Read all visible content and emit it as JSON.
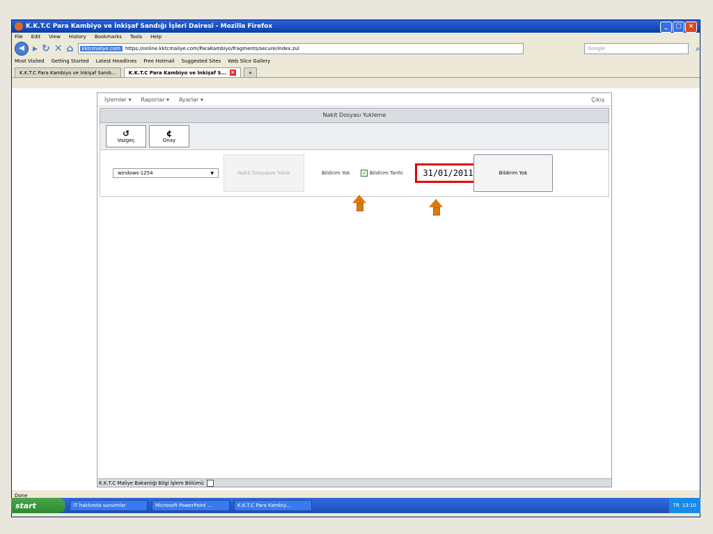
{
  "browser": {
    "title": "K.K.T.C Para Kambiyo ve İnkişaf Sandığı İşleri Dairesi - Mozilla Firefox",
    "menu": [
      "File",
      "Edit",
      "View",
      "History",
      "Bookmarks",
      "Tools",
      "Help"
    ],
    "url_site": "kktcmaliye.com",
    "url": "https://online.kktcmaliye.com/ParaKambiyo/fragments/secure/index.zul",
    "search_placeholder": "Google",
    "bookmarks": [
      "Most Visited",
      "Getting Started",
      "Latest Headlines",
      "Free Hotmail",
      "Suggested Sites",
      "Web Slice Gallery"
    ],
    "tabs": [
      "K.K.T.C Para Kambiyo ve İnkişaf Sandı...",
      "K.K.T.C Para Kambiyo ve İnkişaf S..."
    ],
    "status": "Done"
  },
  "app": {
    "menu": [
      "İşlemler ▾",
      "Raporlar ▾",
      "Ayarlar ▾"
    ],
    "logout": "Çıkış",
    "panel_title": "Nakit Dosyası Yukleme",
    "toolbar": {
      "cancel": "Vazgeç",
      "confirm": "Onay"
    },
    "form": {
      "encoding": "windows-1254",
      "upload": "Nakit Dosyasını Yükle",
      "status": "Bildirim Yok",
      "date_label": "Bildirim Tarihi",
      "date_value": "31/01/2011",
      "notify_button": "Bildirim Yok"
    },
    "footer": "K.K.T.C Maliye Bakanlığı Bilgi İşlem Bölümü"
  },
  "taskbar": {
    "start": "start",
    "tasks": [
      "IT hakkında sunumlar",
      "Microsoft PowerPoint ...",
      "K.K.T.C Para Kambiy..."
    ],
    "lang": "TR",
    "time": "13:10"
  }
}
